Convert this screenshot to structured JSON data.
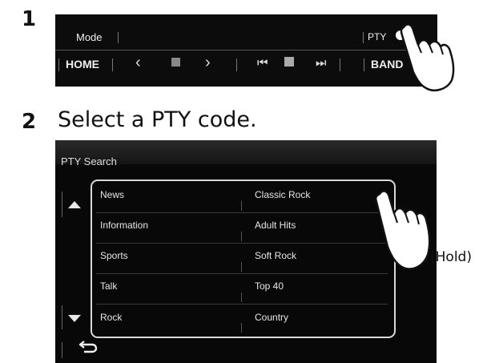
{
  "steps": [
    {
      "number": "1"
    },
    {
      "number": "2",
      "title": "Select a PTY code."
    }
  ],
  "source_control": {
    "mode_label": "Mode",
    "pty_label": "PTY",
    "home_label": "HOME",
    "band_label": "BAND",
    "icons": [
      "chevron-left-icon",
      "stop-square-icon",
      "chevron-right-icon",
      "skip-previous-icon",
      "pause-icon",
      "skip-next-icon"
    ]
  },
  "pty_search": {
    "title": "PTY Search",
    "left_column": [
      "News",
      "Information",
      "Sports",
      "Talk",
      "Rock"
    ],
    "right_column": [
      "Classic Rock",
      "Adult Hits",
      "Soft Rock",
      "Top 40",
      "Country"
    ],
    "scroll_icons": [
      "arrow-up-icon",
      "arrow-down-icon"
    ],
    "back_icon": "back-arrow-icon"
  },
  "hold_label": "(Hold)",
  "colors": {
    "screen_bg": "#0c0c0c",
    "text": "#e6e6e6",
    "frame": "#d8d8d8"
  }
}
